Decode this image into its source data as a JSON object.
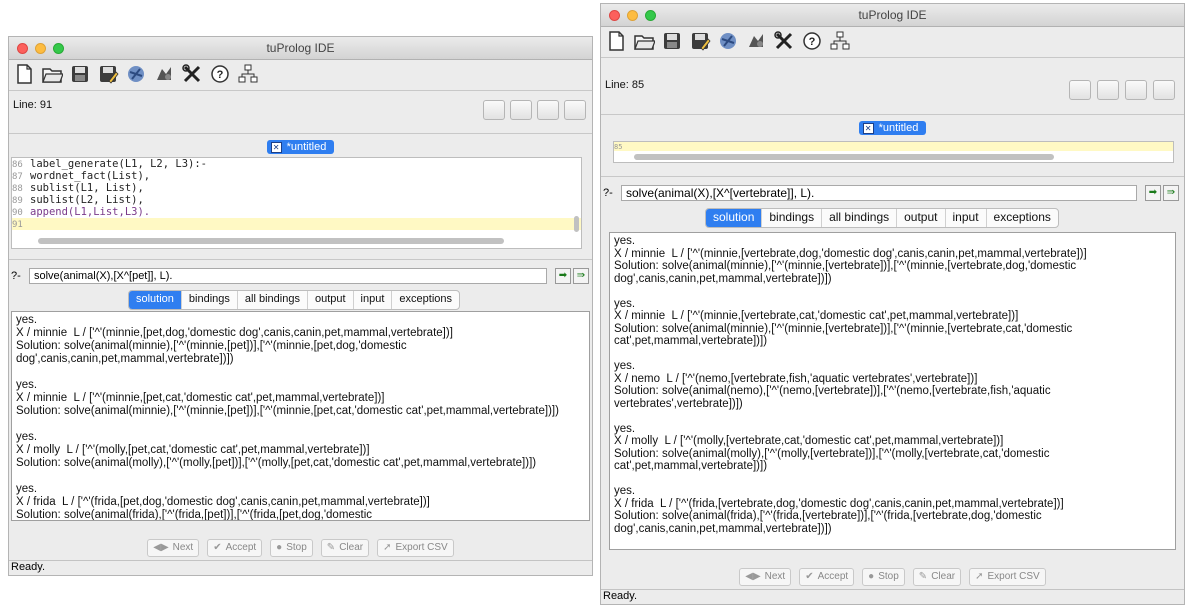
{
  "windows": [
    {
      "title": "tuProlog IDE",
      "line_label": "Line: 91",
      "file_tab": "*untitled",
      "code_lines": [
        {
          "num": "86",
          "text": "label_generate(L1, L2, L3):-"
        },
        {
          "num": "87",
          "text": "wordnet_fact(List),"
        },
        {
          "num": "88",
          "text": "sublist(L1, List),"
        },
        {
          "num": "89",
          "text": "sublist(L2, List),"
        },
        {
          "num": "90",
          "text": "append(L1,List,L3)."
        },
        {
          "num": "91",
          "text": ""
        }
      ],
      "query_prompt": "?-",
      "query": "solve(animal(X),[X^[pet]], L).",
      "tabs": [
        "solution",
        "bindings",
        "all bindings",
        "output",
        "input",
        "exceptions"
      ],
      "active_tab": "solution",
      "output_lines": [
        "yes.",
        "X / minnie  L / ['^'(minnie,[pet,dog,'domestic dog',canis,canin,pet,mammal,vertebrate])]",
        "Solution: solve(animal(minnie),['^'(minnie,[pet])],['^'(minnie,[pet,dog,'domestic dog',canis,canin,pet,mammal,vertebrate])])",
        "",
        "yes.",
        "X / minnie  L / ['^'(minnie,[pet,cat,'domestic cat',pet,mammal,vertebrate])]",
        "Solution: solve(animal(minnie),['^'(minnie,[pet])],['^'(minnie,[pet,cat,'domestic cat',pet,mammal,vertebrate])])",
        "",
        "yes.",
        "X / molly  L / ['^'(molly,[pet,cat,'domestic cat',pet,mammal,vertebrate])]",
        "Solution: solve(animal(molly),['^'(molly,[pet])],['^'(molly,[pet,cat,'domestic cat',pet,mammal,vertebrate])])",
        "",
        "yes.",
        "X / frida  L / ['^'(frida,[pet,dog,'domestic dog',canis,canin,pet,mammal,vertebrate])]",
        "Solution: solve(animal(frida),['^'(frida,[pet])],['^'(frida,[pet,dog,'domestic dog',canis,canin,pet,mammal,vertebrate])])"
      ],
      "buttons": [
        "Next",
        "Accept",
        "Stop",
        "Clear",
        "Export CSV"
      ],
      "status": "Ready."
    },
    {
      "title": "tuProlog IDE",
      "line_label": "Line: 85",
      "file_tab": "*untitled",
      "code_lines": [
        {
          "num": "85",
          "text": ""
        }
      ],
      "query_prompt": "?-",
      "query": "solve(animal(X),[X^[vertebrate]], L).",
      "tabs": [
        "solution",
        "bindings",
        "all bindings",
        "output",
        "input",
        "exceptions"
      ],
      "active_tab": "solution",
      "output_lines": [
        "yes.",
        "X / minnie  L / ['^'(minnie,[vertebrate,dog,'domestic dog',canis,canin,pet,mammal,vertebrate])]",
        "Solution: solve(animal(minnie),['^'(minnie,[vertebrate])],['^'(minnie,[vertebrate,dog,'domestic dog',canis,canin,pet,mammal,vertebrate])])",
        "",
        "yes.",
        "X / minnie  L / ['^'(minnie,[vertebrate,cat,'domestic cat',pet,mammal,vertebrate])]",
        "Solution: solve(animal(minnie),['^'(minnie,[vertebrate])],['^'(minnie,[vertebrate,cat,'domestic cat',pet,mammal,vertebrate])])",
        "",
        "yes.",
        "X / nemo  L / ['^'(nemo,[vertebrate,fish,'aquatic vertebrates',vertebrate])]",
        "Solution: solve(animal(nemo),['^'(nemo,[vertebrate])],['^'(nemo,[vertebrate,fish,'aquatic vertebrates',vertebrate])])",
        "",
        "yes.",
        "X / molly  L / ['^'(molly,[vertebrate,cat,'domestic cat',pet,mammal,vertebrate])]",
        "Solution: solve(animal(molly),['^'(molly,[vertebrate])],['^'(molly,[vertebrate,cat,'domestic cat',pet,mammal,vertebrate])])",
        "",
        "yes.",
        "X / frida  L / ['^'(frida,[vertebrate,dog,'domestic dog',canis,canin,pet,mammal,vertebrate])]",
        "Solution: solve(animal(frida),['^'(frida,[vertebrate])],['^'(frida,[vertebrate,dog,'domestic dog',canis,canin,pet,mammal,vertebrate])])"
      ],
      "buttons": [
        "Next",
        "Accept",
        "Stop",
        "Clear",
        "Export CSV"
      ],
      "status": "Ready."
    }
  ],
  "toolbar_icons": [
    "new-file-icon",
    "open-folder-icon",
    "save-icon",
    "save-as-icon",
    "library-icon",
    "theory-icon",
    "tools-icon",
    "help-icon",
    "network-icon"
  ],
  "colors": {
    "accent": "#2f7ef0",
    "highlight_line": "#fff9c4",
    "window_bg": "#ececec"
  }
}
